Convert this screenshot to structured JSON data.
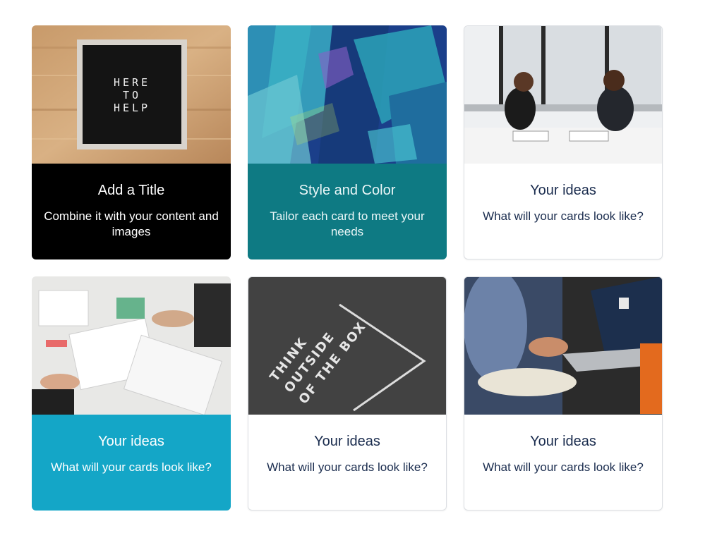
{
  "cards": [
    {
      "title": "Add a Title",
      "text": "Combine it with your content and images",
      "image": "letterboard-photo",
      "letterboard_text": "HERE TO HELP",
      "color": "#000000"
    },
    {
      "title": "Style and Color",
      "text": "Tailor each card to meet your needs",
      "image": "abstract-paint-photo",
      "color": "#0e7a83"
    },
    {
      "title": "Your ideas",
      "text": "What will your cards look like?",
      "image": "meeting-photo",
      "color": "#ffffff"
    },
    {
      "title": "Your ideas",
      "text": "What will your cards look like?",
      "image": "design-table-photo",
      "color": "#14a6c7"
    },
    {
      "title": "Your ideas",
      "text": "What will your cards look like?",
      "image": "chalkboard-photo",
      "chalk_text": "THINK OUTSIDE OF THE BOX",
      "color": "#ffffff"
    },
    {
      "title": "Your ideas",
      "text": "What will your cards look like?",
      "image": "laptop-photo",
      "color": "#ffffff"
    }
  ]
}
